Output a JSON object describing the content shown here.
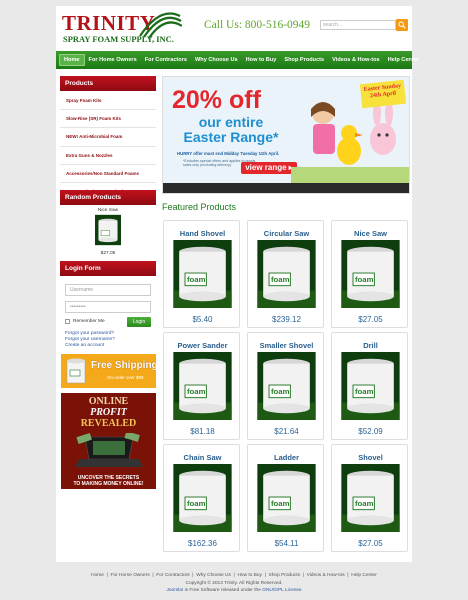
{
  "header": {
    "logo_main": "TRINITY",
    "logo_sub": "SPRAY FOAM SUPPLY, INC.",
    "phone": "Call Us: 800-516-0949",
    "search_placeholder": "search..."
  },
  "nav": {
    "items": [
      "Home",
      "For Home Owners",
      "For Contractors",
      "Why Choose Us",
      "How to Buy",
      "Shop Products",
      "Videos & How-tos",
      "Help Center"
    ],
    "active_index": 0
  },
  "sidebar": {
    "products_title": "Products",
    "products": [
      "Spray Foam Kits",
      "Slow-Rise (SR) Foam Kits",
      "NEW! Anti-Microbial Foam",
      "Extra Guns & Nozzles",
      "Accessories/Non Standard Foams",
      "Accessories/Non Standard Foams"
    ],
    "random_title": "Random Products",
    "random_product": {
      "name": "Nice Saw",
      "price": "$27.05"
    },
    "login_title": "Login Form",
    "username_placeholder": "Username",
    "password_placeholder": "•••••••••",
    "remember_label": "Remember Me",
    "login_button": "Login",
    "forgot_password": "Forgot your password?",
    "forgot_username": "Forgot your username?",
    "create_account": "Create an account",
    "promo_shipping_title": "Free Shipping",
    "promo_shipping_sub": "On order over $99",
    "promo_profit_lines": [
      "ONLINE",
      "PROFIT",
      "REVEALED"
    ],
    "promo_profit_bottom": [
      "UNCOVER THE SECRETS",
      "TO MAKING MONEY ONLINE!"
    ]
  },
  "banner": {
    "headline": "20% off",
    "subhead": "our entire Easter Range*",
    "offer": "HURRY offer must end Midday Tuesday 11th April.",
    "fine_print": "*Excludes special offers and applies to goods sales only (excluding delivery).",
    "button": "view range ▸",
    "tag": "Easter Sunday 24th April"
  },
  "featured": {
    "title": "Featured Products",
    "products": [
      {
        "name": "Hand Shovel",
        "price": "$5.40"
      },
      {
        "name": "Circular Saw",
        "price": "$239.12"
      },
      {
        "name": "Nice Saw",
        "price": "$27.05"
      },
      {
        "name": "Power Sander",
        "price": "$81.18"
      },
      {
        "name": "Smaller Shovel",
        "price": "$21.64"
      },
      {
        "name": "Drill",
        "price": "$52.09"
      },
      {
        "name": "Chain Saw",
        "price": "$162.36"
      },
      {
        "name": "Ladder",
        "price": "$54.11"
      },
      {
        "name": "Shovel",
        "price": "$27.05"
      }
    ]
  },
  "footer": {
    "links": [
      "Home",
      "For Home Owners",
      "For Contractors",
      "Why Choose Us",
      "How to Buy",
      "Shop Products",
      "Videos & How-tos",
      "Help Center"
    ],
    "copyright": "Copyright © 2013 Trinity. All Rights Reserved.",
    "license_prefix": "Joomla!",
    "license_middle": " is Free Software released under the ",
    "license_link": "GNU/GPL License"
  }
}
